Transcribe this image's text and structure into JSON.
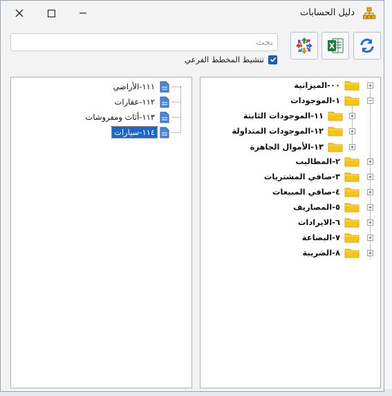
{
  "window": {
    "title": "دليل الحسابات"
  },
  "search": {
    "placeholder": "بحث",
    "value": ""
  },
  "options": {
    "activate_sub_chart": {
      "label": "تنشيط المخطط الفرعي",
      "checked": true
    }
  },
  "toolbar": {
    "refresh_icon": "refresh-icon",
    "excel_icon": "excel-icon",
    "expand_icon": "expand-arrows-icon"
  },
  "tree": {
    "nodes": [
      {
        "label": "٠٠-الميزانية",
        "expander": "+"
      },
      {
        "label": "١-الموجودات",
        "expander": "−"
      },
      {
        "label": "١١-الموجودات الثابتة",
        "expander": "+"
      },
      {
        "label": "١٢-الموجودات المتداولة",
        "expander": "+"
      },
      {
        "label": "١٣-الأموال الجاهزة",
        "expander": "+"
      },
      {
        "label": "٢-المطاليب",
        "expander": "+"
      },
      {
        "label": "٣-صافي المشتريات",
        "expander": "+"
      },
      {
        "label": "٤-صافي المبيعات",
        "expander": "+"
      },
      {
        "label": "٥-المصاريف",
        "expander": "+"
      },
      {
        "label": "٦-الايرادات",
        "expander": "+"
      },
      {
        "label": "٧-البضاعة",
        "expander": "+"
      },
      {
        "label": "٨-الضريبة",
        "expander": "+"
      }
    ]
  },
  "accounts": {
    "items": [
      {
        "label": "١١١-الأراضي",
        "selected": false
      },
      {
        "label": "١١٢-عقارات",
        "selected": false
      },
      {
        "label": "١١٣-أثاث ومفروشات",
        "selected": false
      },
      {
        "label": "١١٤-سيارات",
        "selected": true
      }
    ]
  },
  "colors": {
    "folder": "#f5c518",
    "folder_outline": "#d9a800",
    "selection": "#1e67c8",
    "checkbox": "#1f5fb8"
  }
}
